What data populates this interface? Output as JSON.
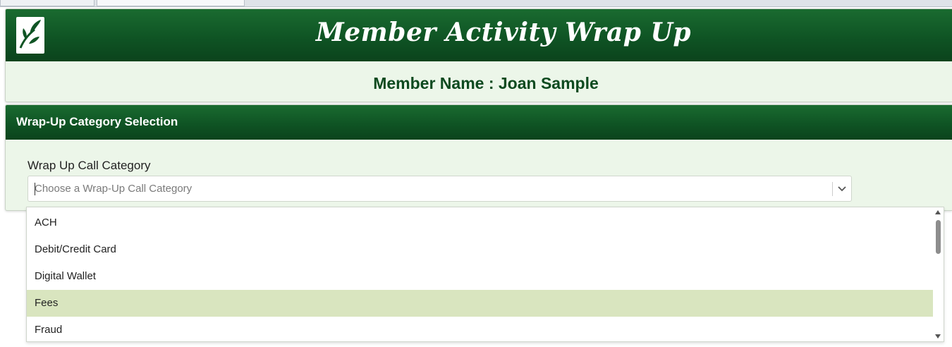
{
  "app": {
    "title": "Member Activity Wrap Up",
    "member_label": "Member Name : Joan Sample",
    "logo_icon": "leaf-icon"
  },
  "section": {
    "title": "Wrap-Up Category Selection",
    "field_label": "Wrap Up Call Category",
    "select_placeholder": "Choose a Wrap-Up Call Category",
    "select_value": ""
  },
  "dropdown": {
    "options": [
      "ACH",
      "Debit/Credit Card",
      "Digital Wallet",
      "Fees",
      "Fraud"
    ],
    "highlighted": "Fees"
  },
  "colors": {
    "header_green": "#0f5424",
    "panel_bg": "#ecf6e9",
    "highlight": "#d9e5bf",
    "member_text": "#0d4a1f"
  }
}
